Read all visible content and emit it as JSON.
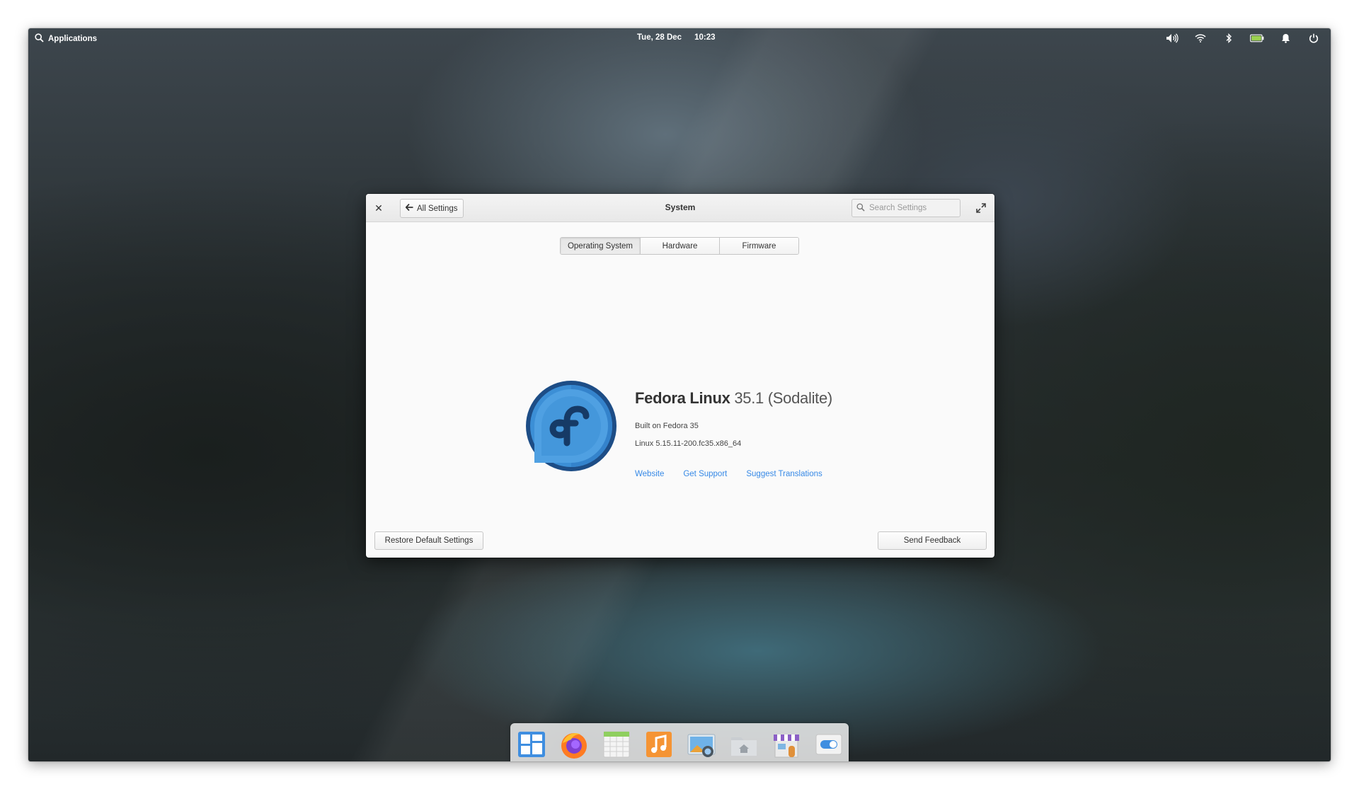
{
  "panel": {
    "applications_label": "Applications",
    "date": "Tue, 28 Dec",
    "time": "10:23",
    "indicators": [
      "volume-icon",
      "wifi-icon",
      "bluetooth-icon",
      "battery-icon",
      "notifications-icon",
      "power-icon"
    ]
  },
  "window": {
    "title": "System",
    "back_label": "All Settings",
    "search_placeholder": "Search Settings",
    "tabs": [
      {
        "label": "Operating System",
        "active": true
      },
      {
        "label": "Hardware",
        "active": false
      },
      {
        "label": "Firmware",
        "active": false
      }
    ],
    "os": {
      "name": "Fedora Linux",
      "version": "35.1 (Sodalite)",
      "built_on": "Built on Fedora 35",
      "kernel": "Linux 5.15.11-200.fc35.x86_64",
      "links": [
        "Website",
        "Get Support",
        "Suggest Translations"
      ]
    },
    "restore_label": "Restore Default Settings",
    "feedback_label": "Send Feedback"
  },
  "dock": {
    "items": [
      "multitasking-view-icon",
      "firefox-icon",
      "calendar-icon",
      "music-icon",
      "photos-icon",
      "files-icon",
      "appcenter-icon",
      "settings-icon"
    ]
  },
  "colors": {
    "accent": "#3689e6",
    "logo_blue": "#3c8fd6",
    "logo_dark": "#1d4d86"
  }
}
